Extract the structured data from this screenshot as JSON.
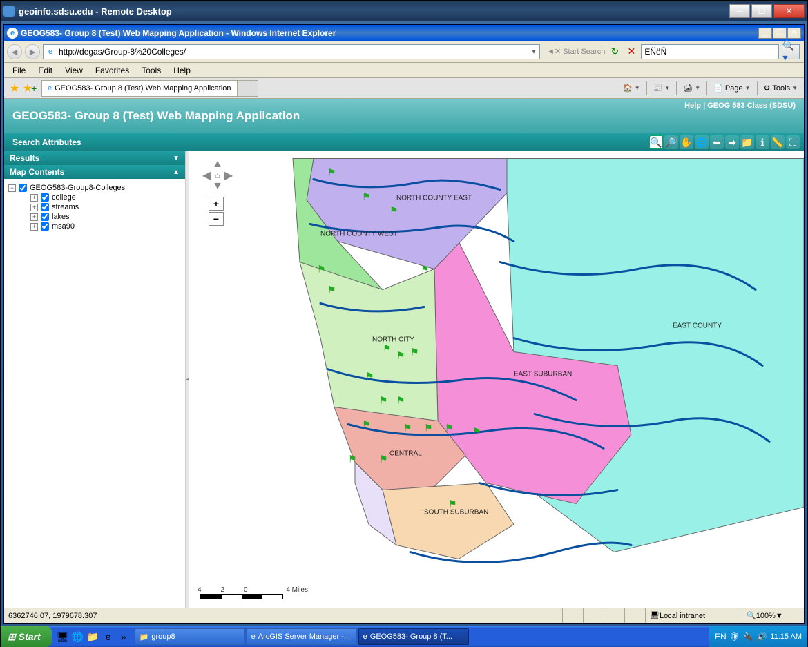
{
  "rd": {
    "title": "geoinfo.sdsu.edu - Remote Desktop"
  },
  "ie": {
    "title": "GEOG583- Group 8 (Test) Web Mapping Application - Windows Internet Explorer",
    "url": "http://degas/Group-8%20Colleges/",
    "search_placeholder": "Start Search",
    "search_value": "ËÑëÑ",
    "menus": {
      "file": "File",
      "edit": "Edit",
      "view": "View",
      "favorites": "Favorites",
      "tools": "Tools",
      "help": "Help"
    },
    "tab_title": "GEOG583- Group 8 (Test) Web Mapping Application",
    "cmd": {
      "page": "Page",
      "tools": "Tools"
    },
    "status_coords": "6362746.07, 1979678.307",
    "status_zone": "Local intranet",
    "status_zoom": "100%"
  },
  "app": {
    "title": "GEOG583- Group 8 (Test) Web Mapping Application",
    "links": {
      "help": "Help",
      "class": "GEOG 583 Class (SDSU)",
      "sep": "  |  "
    },
    "toolbar_label": "Search Attributes",
    "panels": {
      "results": "Results",
      "contents": "Map Contents"
    },
    "layer_root": "GEOG583-Group8-Colleges",
    "layers": [
      "college",
      "streams",
      "lakes",
      "msa90"
    ],
    "regions": {
      "nc_east": "NORTH COUNTY EAST",
      "nc_west": "NORTH COUNTY WEST",
      "north_city": "NORTH CITY",
      "east_county": "EAST COUNTY",
      "east_suburban": "EAST SUBURBAN",
      "central": "CENTRAL",
      "south_suburban": "SOUTH SUBURBAN"
    },
    "scalebar": {
      "t0": "4",
      "t1": "2",
      "t2": "0",
      "t3": "4 Miles"
    }
  },
  "taskbar": {
    "start": "Start",
    "tasks": [
      {
        "label": "group8",
        "icon": "📁"
      },
      {
        "label": "ArcGIS Server Manager -...",
        "icon": "e"
      },
      {
        "label": "GEOG583- Group 8 (T...",
        "icon": "e",
        "active": true
      }
    ],
    "time": "11:15 AM",
    "lang": "EN"
  }
}
